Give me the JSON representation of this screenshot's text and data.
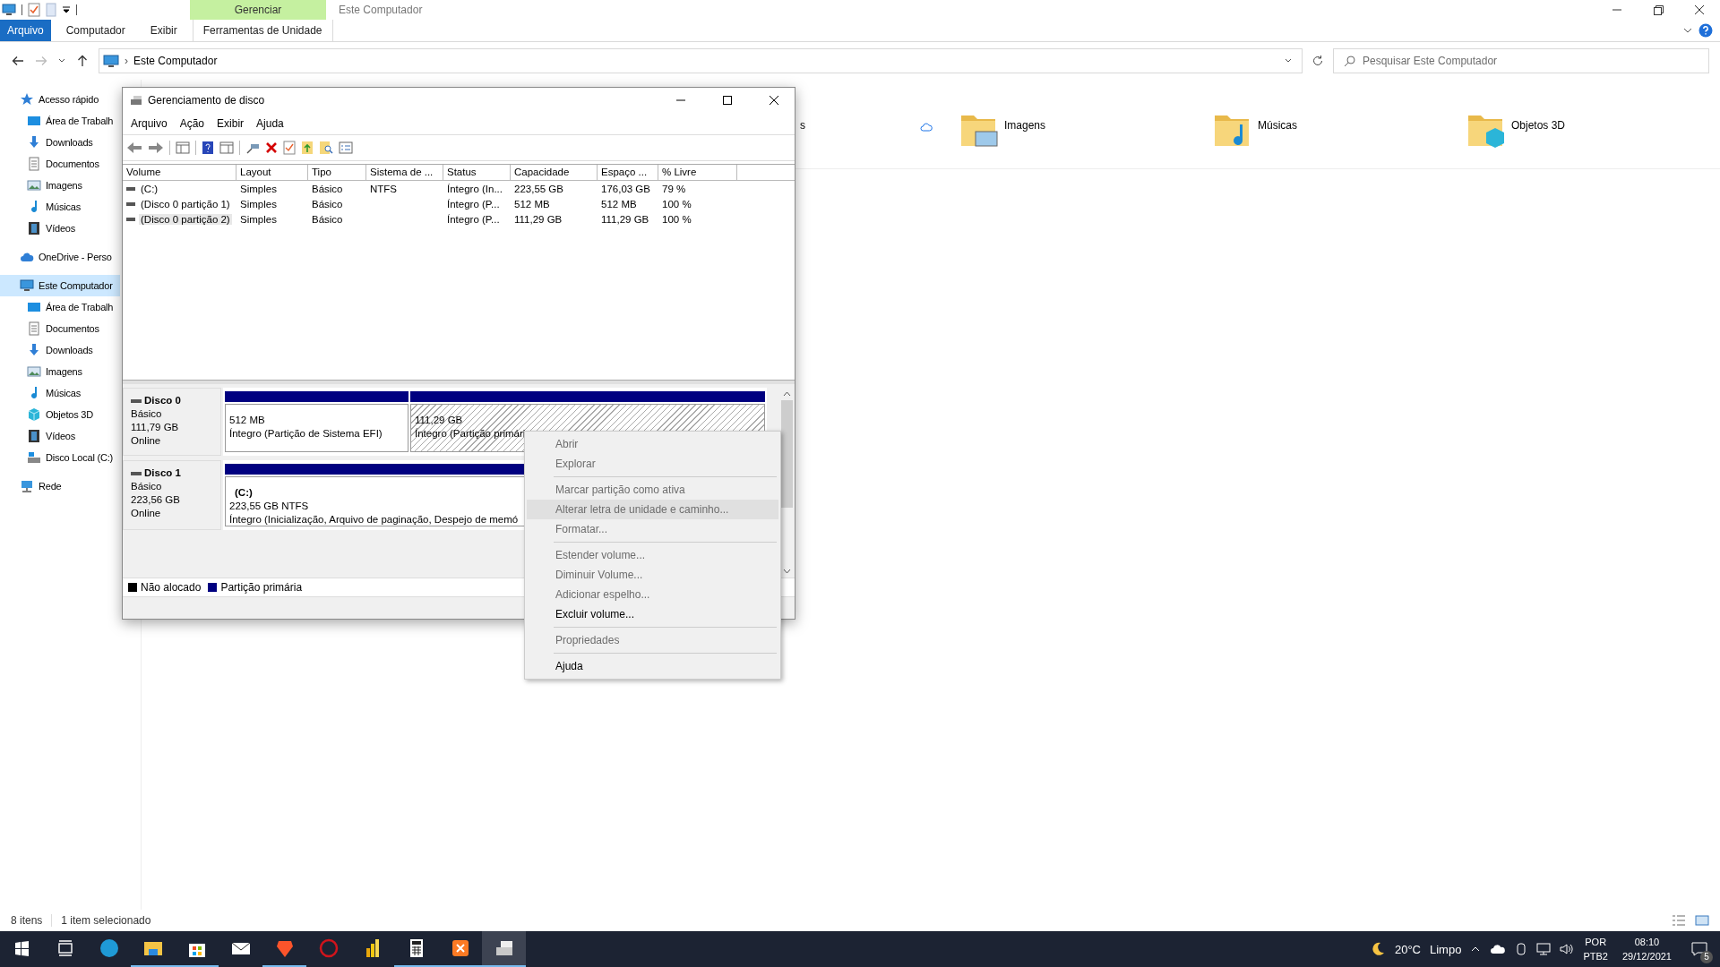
{
  "explorer": {
    "title": "Este Computador",
    "context_group": "Gerenciar",
    "ribbon_tabs": [
      {
        "label": "Arquivo",
        "kind": "file"
      },
      {
        "label": "Computador",
        "kind": "tab"
      },
      {
        "label": "Exibir",
        "kind": "tab"
      },
      {
        "label": "Ferramentas de Unidade",
        "kind": "context"
      }
    ],
    "address_separator": "›",
    "address": "Este Computador",
    "search": {
      "placeholder": "Pesquisar Este Computador"
    },
    "nav": [
      {
        "label": "Acesso rápido",
        "kind": "star",
        "selected": false,
        "children": [
          {
            "label": "Área de Trabalh",
            "kind": "desktop",
            "selected": false
          },
          {
            "label": "Downloads",
            "kind": "download",
            "selected": false
          },
          {
            "label": "Documentos",
            "kind": "doc",
            "selected": false
          },
          {
            "label": "Imagens",
            "kind": "pictures",
            "selected": false
          },
          {
            "label": "Músicas",
            "kind": "music",
            "selected": false
          },
          {
            "label": "Vídeos",
            "kind": "video",
            "selected": false
          }
        ]
      },
      {
        "label": "OneDrive - Perso",
        "kind": "cloud",
        "selected": false
      },
      {
        "label": "Este Computador",
        "kind": "pc",
        "selected": true,
        "children": [
          {
            "label": "Área de Trabalh",
            "kind": "desktop",
            "selected": false
          },
          {
            "label": "Documentos",
            "kind": "doc",
            "selected": false
          },
          {
            "label": "Downloads",
            "kind": "download",
            "selected": false
          },
          {
            "label": "Imagens",
            "kind": "pictures",
            "selected": false
          },
          {
            "label": "Músicas",
            "kind": "music",
            "selected": false
          },
          {
            "label": "Objetos 3D",
            "kind": "cube",
            "selected": false
          },
          {
            "label": "Vídeos",
            "kind": "video",
            "selected": false
          },
          {
            "label": "Disco Local (C:)",
            "kind": "drive",
            "selected": false
          }
        ]
      },
      {
        "label": "Rede",
        "kind": "network",
        "selected": false
      }
    ],
    "folders": [
      {
        "label": "s",
        "kind": "hidden",
        "cloud": true
      },
      {
        "label": "Imagens",
        "kind": "pictures",
        "cloud": false
      },
      {
        "label": "Músicas",
        "kind": "music",
        "cloud": false
      },
      {
        "label": "Objetos 3D",
        "kind": "cube",
        "cloud": false
      }
    ],
    "status": {
      "count": "8 itens",
      "selection": "1 item selecionado"
    }
  },
  "disk_window": {
    "title": "Gerenciamento de disco",
    "menu": [
      "Arquivo",
      "Ação",
      "Exibir",
      "Ajuda"
    ],
    "columns": [
      "Volume",
      "Layout",
      "Tipo",
      "Sistema de ...",
      "Status",
      "Capacidade",
      "Espaço ...",
      "% Livre"
    ],
    "rows": [
      {
        "cells": [
          "(C:)",
          "Simples",
          "Básico",
          "NTFS",
          "Íntegro (In...",
          "223,55 GB",
          "176,03 GB",
          "79 %"
        ],
        "selected": false
      },
      {
        "cells": [
          "(Disco 0 partição 1)",
          "Simples",
          "Básico",
          "",
          "Íntegro (P...",
          "512 MB",
          "512 MB",
          "100 %"
        ],
        "selected": false
      },
      {
        "cells": [
          "(Disco 0 partição 2)",
          "Simples",
          "Básico",
          "",
          "Íntegro (P...",
          "111,29 GB",
          "111,29 GB",
          "100 %"
        ],
        "selected": true
      }
    ],
    "disks": [
      {
        "name": "Disco 0",
        "type": "Básico",
        "size": "111,79 GB",
        "status": "Online",
        "partitions": [
          {
            "size": "512 MB",
            "status": "Íntegro (Partição de Sistema EFI)",
            "selected": false
          },
          {
            "size": "111,29 GB",
            "status": "Íntegro (Partição primári",
            "selected": true
          }
        ]
      },
      {
        "name": "Disco 1",
        "type": "Básico",
        "size": "223,56 GB",
        "status": "Online",
        "partitions": [
          {
            "label": "(C:)",
            "size": "223,55 GB NTFS",
            "status": "Íntegro (Inicialização, Arquivo de paginação, Despejo de memó",
            "selected": false
          }
        ]
      }
    ],
    "legend": [
      {
        "label": "Não alocado",
        "color": "#000000"
      },
      {
        "label": "Partição primária",
        "color": "#000080"
      }
    ]
  },
  "context_menu": [
    {
      "kind": "item",
      "label": "Abrir",
      "disabled": true,
      "highlighted": false
    },
    {
      "kind": "item",
      "label": "Explorar",
      "disabled": true,
      "highlighted": false
    },
    {
      "kind": "separator"
    },
    {
      "kind": "item",
      "label": "Marcar partição como ativa",
      "disabled": true,
      "highlighted": false
    },
    {
      "kind": "item",
      "label": "Alterar letra de unidade e caminho...",
      "disabled": true,
      "highlighted": true
    },
    {
      "kind": "item",
      "label": "Formatar...",
      "disabled": true,
      "highlighted": false
    },
    {
      "kind": "separator"
    },
    {
      "kind": "item",
      "label": "Estender volume...",
      "disabled": true,
      "highlighted": false
    },
    {
      "kind": "item",
      "label": "Diminuir Volume...",
      "disabled": true,
      "highlighted": false
    },
    {
      "kind": "item",
      "label": "Adicionar espelho...",
      "disabled": true,
      "highlighted": false
    },
    {
      "kind": "item",
      "label": "Excluir volume...",
      "disabled": false,
      "highlighted": false
    },
    {
      "kind": "separator"
    },
    {
      "kind": "item",
      "label": "Propriedades",
      "disabled": true,
      "highlighted": false
    },
    {
      "kind": "separator"
    },
    {
      "kind": "item",
      "label": "Ajuda",
      "disabled": false,
      "highlighted": false
    }
  ],
  "taskbar": {
    "apps": [
      {
        "kind": "taskview",
        "open": false,
        "active": false
      },
      {
        "kind": "edge",
        "open": false,
        "active": false
      },
      {
        "kind": "explorer",
        "open": true,
        "active": false
      },
      {
        "kind": "store",
        "open": true,
        "active": false
      },
      {
        "kind": "mail",
        "open": false,
        "active": false
      },
      {
        "kind": "brave",
        "open": true,
        "active": false
      },
      {
        "kind": "antivirus",
        "open": false,
        "active": false
      },
      {
        "kind": "chart",
        "open": false,
        "active": false
      },
      {
        "kind": "calculator",
        "open": true,
        "active": false
      },
      {
        "kind": "xampp",
        "open": true,
        "active": false
      },
      {
        "kind": "diskmgmt",
        "open": true,
        "active": true
      }
    ],
    "temperature": "20°C",
    "weather": "Limpo",
    "language": "POR",
    "layout": "PTB2",
    "time": "08:10",
    "date": "29/12/2021",
    "notifications": "5"
  }
}
